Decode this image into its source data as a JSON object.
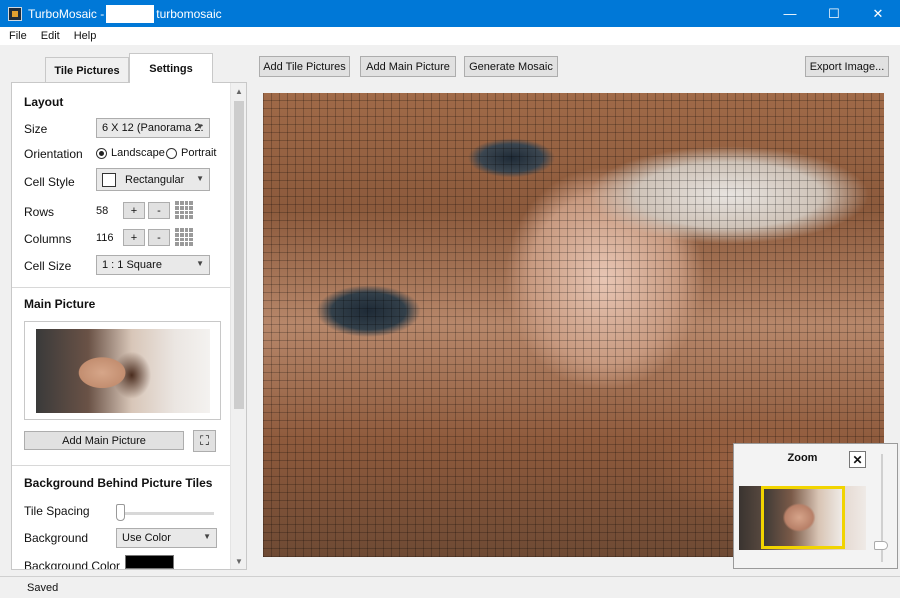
{
  "window": {
    "title_prefix": "TurboMosaic -",
    "title_suffix": "turbomosaic",
    "controls": {
      "minimize": "—",
      "maximize": "☐",
      "close": "✕"
    },
    "titlebar_color": "#0078d7"
  },
  "menu": {
    "items": [
      "File",
      "Edit",
      "Help"
    ]
  },
  "tabs": [
    {
      "label": "Tile Pictures",
      "active": false
    },
    {
      "label": "Settings",
      "active": true
    }
  ],
  "layout": {
    "title": "Layout",
    "size_label": "Size",
    "size_value": "6 X 12 (Panorama 2:",
    "orientation_label": "Orientation",
    "orientation_options": [
      "Landscape",
      "Portrait"
    ],
    "orientation_selected": "Landscape",
    "cell_style_label": "Cell Style",
    "cell_style_value": "Rectangular",
    "rows_label": "Rows",
    "rows_value": "58",
    "columns_label": "Columns",
    "columns_value": "116",
    "cell_size_label": "Cell Size",
    "cell_size_value": "1 : 1 Square",
    "plus": "+",
    "minus": "-"
  },
  "main_picture": {
    "title": "Main Picture",
    "add_button": "Add Main Picture",
    "crop_icon": "crop-icon"
  },
  "background": {
    "title": "Background Behind Picture Tiles",
    "tile_spacing_label": "Tile Spacing",
    "tile_spacing_value": 0,
    "background_label": "Background",
    "background_value": "Use Color",
    "background_color_label": "Background Color",
    "background_color": "#000000"
  },
  "toolbar": {
    "add_tile_pictures": "Add Tile Pictures",
    "add_main_picture": "Add Main Picture",
    "generate_mosaic": "Generate Mosaic",
    "export_image": "Export Image..."
  },
  "zoom": {
    "title": "Zoom",
    "close": "✕",
    "highlight_color": "#f1d400"
  },
  "status": {
    "text": "Saved"
  }
}
